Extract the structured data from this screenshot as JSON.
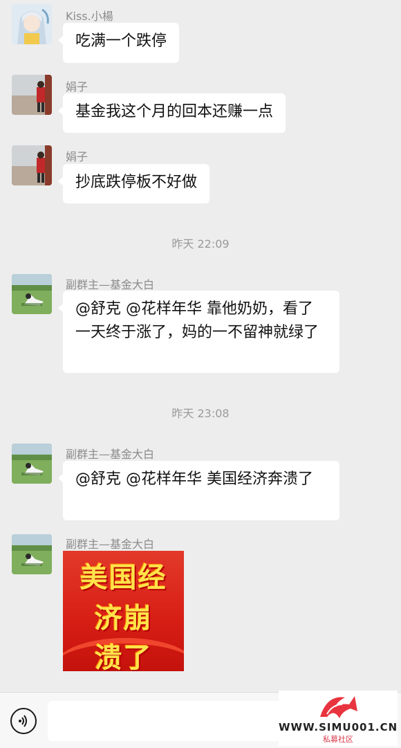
{
  "messages": [
    {
      "sender": "Kiss.小楊",
      "text": "吃满一个跌停"
    },
    {
      "sender": "娟子",
      "text": "基金我这个月的回本还赚一点"
    },
    {
      "sender": "娟子",
      "text": "抄底跌停板不好做"
    },
    {
      "timestamp": "昨天 22:09"
    },
    {
      "sender": "副群主—基金大白",
      "text": "@舒克 @花样年华 靠他奶奶，看了一天终于涨了，妈的一不留神就绿了"
    },
    {
      "timestamp": "昨天 23:08"
    },
    {
      "sender": "副群主—基金大白",
      "text": "@舒克 @花样年华 美国经济奔溃了"
    },
    {
      "sender": "副群主—基金大白",
      "sticker_lines": [
        "美国经",
        "济崩",
        "溃了"
      ]
    }
  ],
  "watermark": {
    "text": "WWW.SIMU001.CN",
    "sub": "私募社区"
  }
}
